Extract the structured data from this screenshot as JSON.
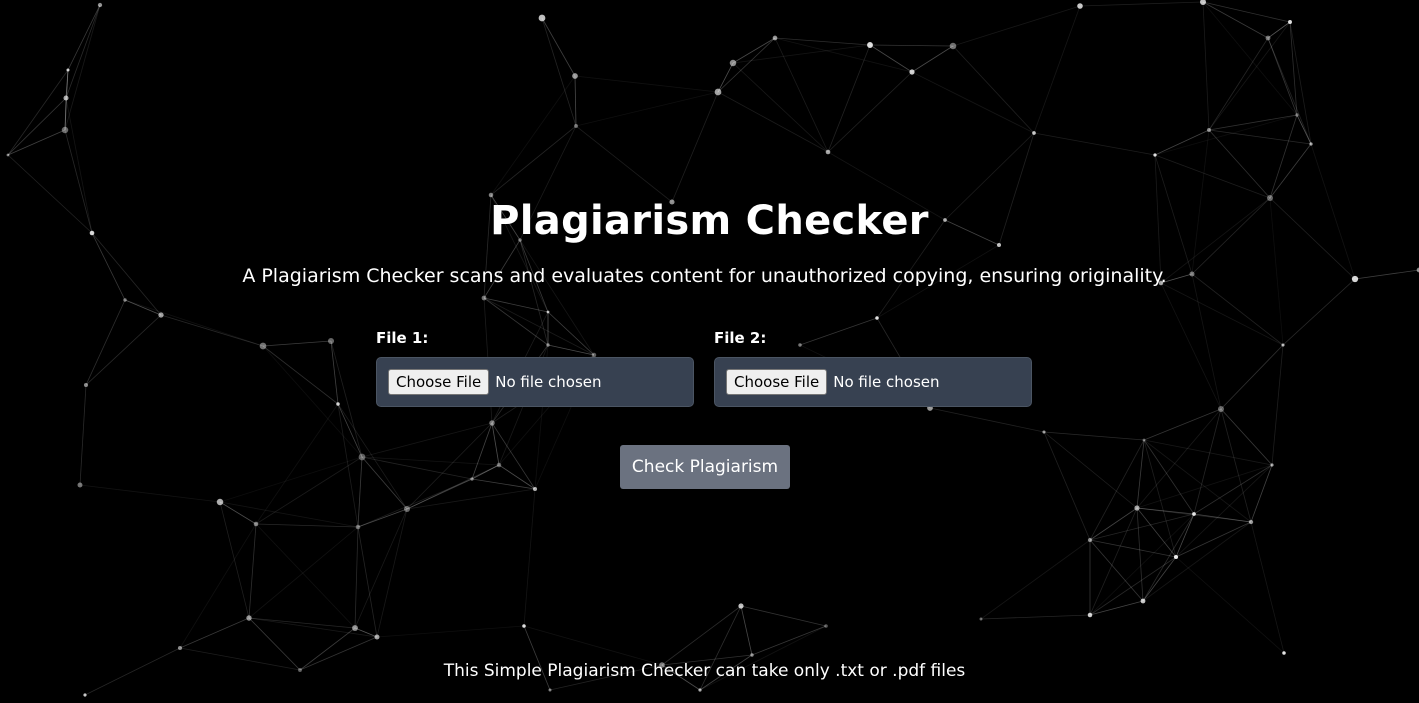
{
  "page": {
    "title": "Plagiarism Checker",
    "subtitle": "A Plagiarism Checker scans and evaluates content for unauthorized copying, ensuring originality."
  },
  "form": {
    "file1": {
      "label": "File 1:",
      "button_label": "Choose File",
      "status": "No file chosen"
    },
    "file2": {
      "label": "File 2:",
      "button_label": "Choose File",
      "status": "No file chosen"
    },
    "submit_label": "Check Plagiarism"
  },
  "footer": {
    "note": "This Simple Plagiarism Checker can take only .txt or .pdf files"
  },
  "colors": {
    "background": "#000000",
    "input_box": "#374151",
    "submit_button": "#6b7280",
    "network_line": "#ffffff"
  },
  "background_decoration": "particle-network"
}
